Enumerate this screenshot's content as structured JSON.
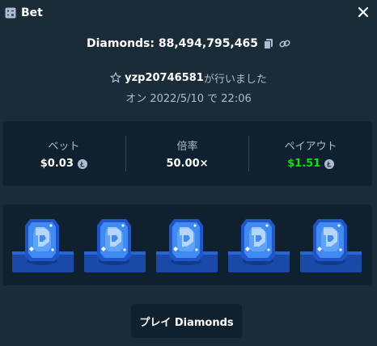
{
  "header": {
    "title": "Bet",
    "icon": "bet-slip-icon",
    "close_icon": "close-icon"
  },
  "bet": {
    "id_label": "Diamonds: 88,494,795,465",
    "copy_icon": "copy-icon",
    "link_icon": "link-icon",
    "user": {
      "name": "yzp20746581",
      "suffix": "が行いました",
      "icon": "star-outline-icon"
    },
    "date_text": "オン 2022/5/10 で 22:06"
  },
  "stats": {
    "bet_label": "ベット",
    "bet_value": "$0.03",
    "multiplier_label": "倍率",
    "multiplier_value": "50.00×",
    "payout_label": "ペイアウト",
    "payout_value": "$1.51",
    "currency_icon": "litecoin-icon",
    "colors": {
      "payout": "#00e701"
    }
  },
  "board": {
    "gems": [
      {
        "color": "blue",
        "icon": "blue-diamond-icon"
      },
      {
        "color": "blue",
        "icon": "blue-diamond-icon"
      },
      {
        "color": "blue",
        "icon": "blue-diamond-icon"
      },
      {
        "color": "blue",
        "icon": "blue-diamond-icon"
      },
      {
        "color": "blue",
        "icon": "blue-diamond-icon"
      }
    ]
  },
  "play_button": {
    "label": "プレイ Diamonds"
  }
}
